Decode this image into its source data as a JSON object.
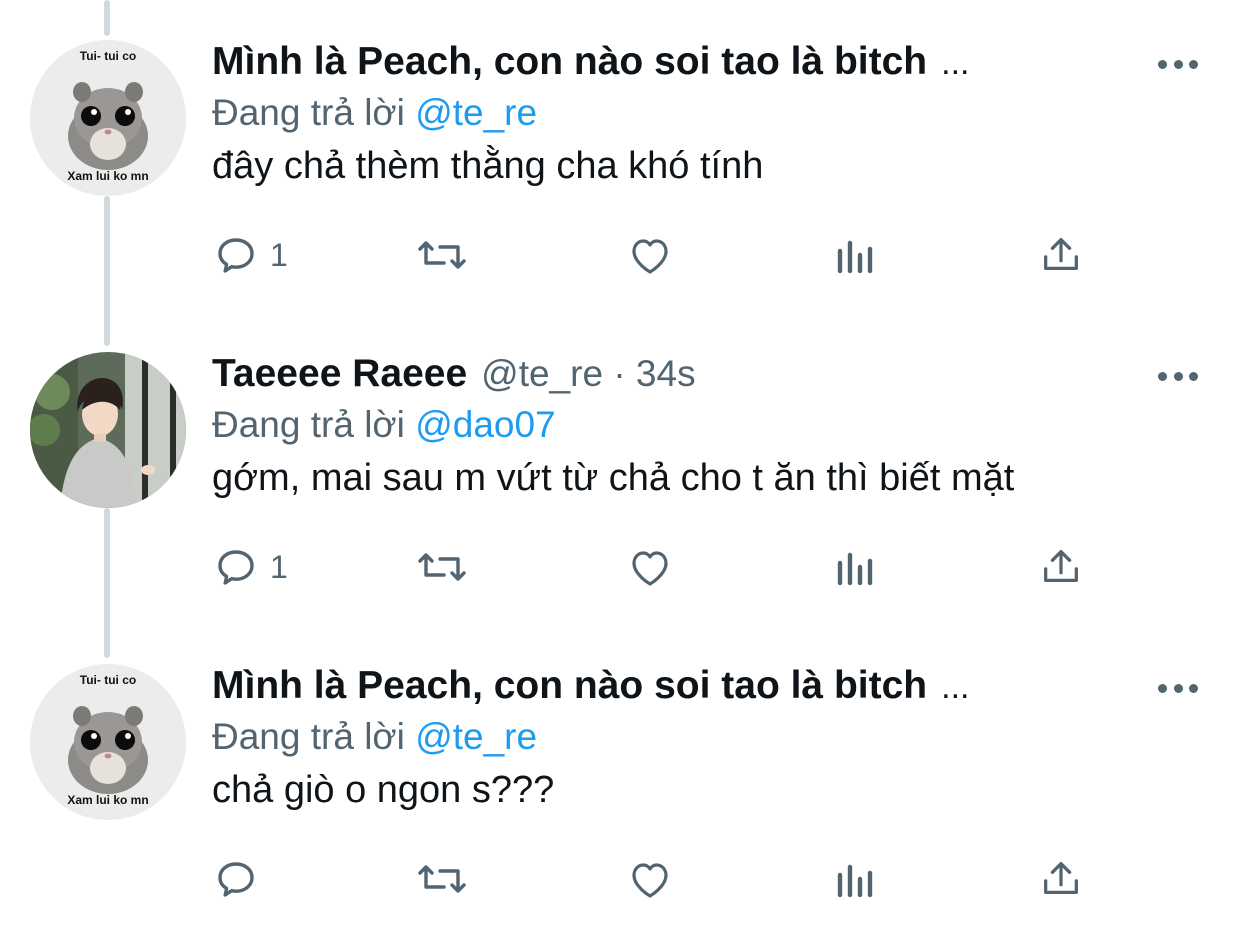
{
  "tweets": [
    {
      "display_name": "Mình là Peach, con nào soi tao là bitch",
      "overflow": "...",
      "handle_time": "",
      "reply_prefix": "Đang trả lời",
      "reply_mention": "@te_re",
      "text": "đây chả thèm thằng cha khó tính",
      "reply_count": "1",
      "avatar": {
        "type": "hamster",
        "top_text": "Tui- tui co",
        "bottom_text": "Xam lui ko mn"
      }
    },
    {
      "display_name": "Taeeee Raeee",
      "overflow": "",
      "handle_time": "@te_re · 34s",
      "reply_prefix": "Đang trả lời",
      "reply_mention": "@dao07",
      "text": "gớm, mai sau m vứt từ chả cho t ăn thì biết mặt",
      "reply_count": "1",
      "avatar": {
        "type": "photo"
      }
    },
    {
      "display_name": "Mình là Peach, con nào soi tao là bitch",
      "overflow": "...",
      "handle_time": "",
      "reply_prefix": "Đang trả lời",
      "reply_mention": "@te_re",
      "text": "chả giò o ngon s???",
      "reply_count": "",
      "avatar": {
        "type": "hamster",
        "top_text": "Tui- tui co",
        "bottom_text": "Xam lui ko mn"
      }
    }
  ],
  "icons": {
    "reply": "reply-icon",
    "retweet": "retweet-icon",
    "like": "like-icon",
    "analytics": "analytics-icon",
    "share": "share-icon",
    "more": "more-icon"
  },
  "colors": {
    "text": "#0f1419",
    "secondary": "#536471",
    "mention": "#1d9bf0",
    "thread_line": "#cfd9de"
  }
}
